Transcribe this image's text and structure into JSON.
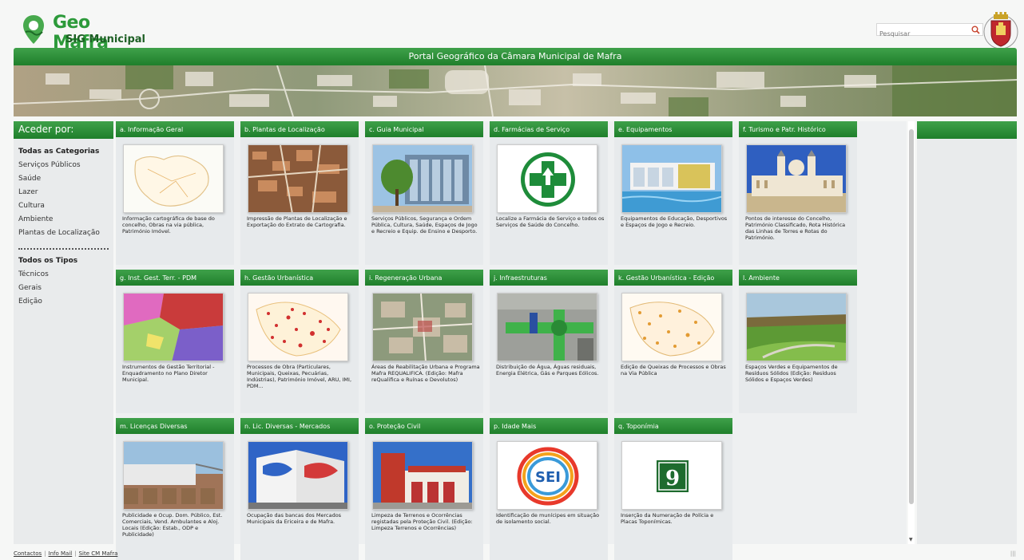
{
  "header": {
    "logo_line1": "Geo Mafra",
    "logo_line2": "SIG Municipal",
    "search_placeholder": "Pesquisar"
  },
  "title_bar": "Portal Geográfico da Câmara Municipal de Mafra",
  "sidebar": {
    "title": "Aceder por:",
    "categories": [
      {
        "label": "Todas as Categorias",
        "bold": true
      },
      {
        "label": "Serviços Públicos"
      },
      {
        "label": "Saúde"
      },
      {
        "label": "Lazer"
      },
      {
        "label": "Cultura"
      },
      {
        "label": "Ambiente"
      },
      {
        "label": "Plantas de Localização"
      }
    ],
    "types": [
      {
        "label": "Todos os Tipos",
        "bold": true
      },
      {
        "label": "Técnicos"
      },
      {
        "label": "Gerais"
      },
      {
        "label": "Edição"
      }
    ]
  },
  "cards": [
    {
      "title": "a. Informação Geral",
      "icon": "map-outline-image",
      "desc": "Informação cartográfica de base do concelho, Obras na via pública, Património Imóvel."
    },
    {
      "title": "b. Plantas de Localização",
      "icon": "aerial-town-image",
      "desc": "Impressão de Plantas de Localização e Exportação do Extrato de Cartografia."
    },
    {
      "title": "c. Guia Municipal",
      "icon": "municipal-building-image",
      "desc": "Serviços Públicos, Segurança e Ordem Pública, Cultura, Saúde, Espaços de Jogo e Recreio e Equip. de Ensino e Desporto."
    },
    {
      "title": "d. Farmácias de Serviço",
      "icon": "pharmacy-cross-image",
      "desc": "Localize a Farmácia de Serviço e todos os Serviços de Saúde do Concelho."
    },
    {
      "title": "e. Equipamentos",
      "icon": "sports-facility-image",
      "desc": "Equipamentos de Educação, Desportivos e Espaços de Jogo e Recreio."
    },
    {
      "title": "f. Turismo e Patr. Histórico",
      "icon": "palace-image",
      "desc": "Pontos de interesse do Concelho, Património Classificado, Rota Histórica das Linhas de Torres e Rotas do Património."
    },
    {
      "title": "g. Inst. Gest. Terr. - PDM",
      "icon": "zoning-map-image",
      "desc": "Instrumentos de Gestão Territorial - Enquadramento no Plano Diretor Municipal."
    },
    {
      "title": "h. Gestão Urbanística",
      "icon": "red-dots-map-image",
      "desc": "Processos de Obra (Particulares, Municipais, Queixas, Pecuárias, Indústrias), Património Imóvel, ARU, IMI, PDM..."
    },
    {
      "title": "i. Regeneração Urbana",
      "icon": "aerial-center-image",
      "desc": "Áreas de Reabilitação Urbana e Programa Mafra REQUALIFICA. (Edição: Mafra reQualifica e Ruínas e Devolutos)"
    },
    {
      "title": "j. Infraestruturas",
      "icon": "pipes-image",
      "desc": "Distribuição de Água, Águas residuais, Energia Elétrica, Gás e Parques Eólicos."
    },
    {
      "title": "k. Gestão Urbanística - Edição",
      "icon": "orange-dots-map-image",
      "desc": "Edição de Queixas de Processos e Obras na Via Pública"
    },
    {
      "title": "l. Ambiente",
      "icon": "green-park-image",
      "desc": "Espaços Verdes e Equipamentos de Resíduos Sólidos (Edição: Resíduos Sólidos e Espaços Verdes)"
    },
    {
      "title": "m. Licenças Diversas",
      "icon": "market-stalls-image",
      "desc": "Publicidade e Ocup. Dom. Público, Est. Comerciais, Vend. Ambulantes e Aloj. Locais (Edição: Estab., ODP e Publicidade)"
    },
    {
      "title": "n. Lic. Diversas - Mercados",
      "icon": "market-building-image",
      "desc": "Ocupação das bancas dos Mercados Municipais da Ericeira e de Mafra."
    },
    {
      "title": "o. Proteção Civil",
      "icon": "fire-station-image",
      "desc": "Limpeza de Terrenos e Ocorrências registadas pela Proteção Civil. (Edição: Limpeza Terrenos e Ocorrências)"
    },
    {
      "title": "p. Idade Mais",
      "icon": "sei-logo-image",
      "logo_text": "SEI",
      "desc": "Identificação de munícipes em situação de isolamento social."
    },
    {
      "title": "q. Toponímia",
      "icon": "house-number-image",
      "number": "9",
      "desc": "Inserção da Numeração de Polícia e Placas Toponímicas."
    }
  ],
  "footer": {
    "links": [
      "Contactos",
      "Info Mail",
      "Site CM Mafra"
    ]
  },
  "colors": {
    "brand_green": "#2c9a3a",
    "header_green_top": "#3fa14a",
    "header_green_bottom": "#1f7f2b"
  }
}
